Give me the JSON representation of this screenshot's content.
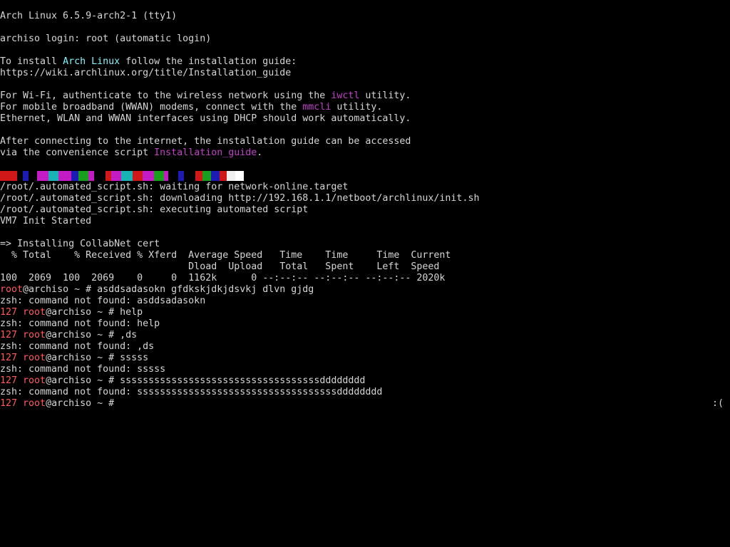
{
  "terminal": {
    "header": "Arch Linux 6.5.9-arch2-1 (tty1)",
    "login_line": "archiso login: root (automatic login)",
    "install": {
      "prefix": "To install ",
      "highlight": "Arch Linux",
      "suffix": " follow the installation guide:",
      "url": "https://wiki.archlinux.org/title/Installation_guide"
    },
    "wifi": {
      "prefix": "For Wi-Fi, authenticate to the wireless network using the ",
      "tool": "iwctl",
      "suffix": " utility."
    },
    "wwan": {
      "prefix": "For mobile broadband (WWAN) modems, connect with the ",
      "tool": "mmcli",
      "suffix": " utility."
    },
    "dhcp_line": "Ethernet, WLAN and WWAN interfaces using DHCP should work automatically.",
    "after_line": "After connecting to the internet, the installation guide can be accessed",
    "script": {
      "prefix": "via the convenience script ",
      "name": "Installation_guide",
      "suffix": "."
    },
    "color_bar": [
      "#d01818",
      "#000000",
      "#1c1cb4",
      "#000000",
      "#c41cc4",
      "#18b4b4",
      "#c41cc4",
      "#1c1cb4",
      "#18a01c",
      "#c41cc4",
      "#000000",
      "#d01818",
      "#c41cc4",
      "#18b4b4",
      "#d01818",
      "#c41cc4",
      "#18a01c",
      "#c41cc4",
      "#000000",
      "#1c1cb4",
      "#000000",
      "#d01818",
      "#18a01c",
      "#1c1cb4",
      "#d01818",
      "#f0f0f0",
      "#ffffff"
    ],
    "script_lines": [
      "/root/.automated_script.sh: waiting for network-online.target",
      "/root/.automated_script.sh: downloading http://192.168.1.1/netboot/archlinux/init.sh",
      "/root/.automated_script.sh: executing automated script",
      "VM7 Init Started"
    ],
    "cert_line": "=> Installing CollabNet cert",
    "curl_header_1": "  % Total    % Received % Xferd  Average Speed   Time    Time     Time  Current",
    "curl_header_2": "                                 Dload  Upload   Total   Spent    Left  Speed",
    "curl_progress": "100  2069  100  2069    0     0  1162k      0 --:--:-- --:--:-- --:--:-- 2020k",
    "prompt": {
      "user": "root",
      "host": "@archiso ~ # ",
      "error_code": "127 "
    },
    "history": [
      {
        "code": "",
        "command": "asddsadasokn gfdkskjdkjdsvkj dlvn gjdg",
        "output": "zsh: command not found: asddsadasokn"
      },
      {
        "code": "127 ",
        "command": "help",
        "output": "zsh: command not found: help"
      },
      {
        "code": "127 ",
        "command": ",ds",
        "output": "zsh: command not found: ,ds"
      },
      {
        "code": "127 ",
        "command": "sssss",
        "output": "zsh: command not found: sssss"
      },
      {
        "code": "127 ",
        "command": "sssssssssssssssssssssssssssssssssssdddddddd",
        "output": "zsh: command not found: sssssssssssssssssssssssssssssssssssdddddddd"
      }
    ],
    "right_prompt": ":("
  }
}
